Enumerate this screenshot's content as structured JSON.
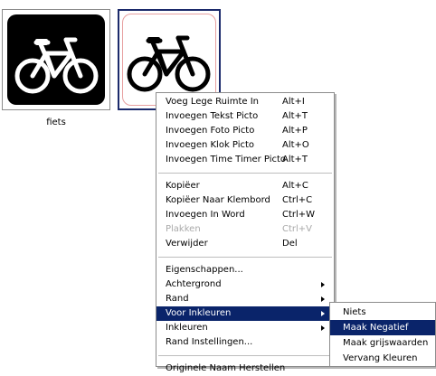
{
  "tiles": [
    {
      "label": "fiets",
      "style": "negative",
      "icon": "bicycle-icon"
    },
    {
      "label": "",
      "style": "normal",
      "icon": "bicycle-icon"
    }
  ],
  "context_menu": {
    "group1": [
      {
        "label": "Voeg Lege Ruimte In",
        "shortcut": "Alt+I"
      },
      {
        "label": "Invoegen Tekst Picto",
        "shortcut": "Alt+T"
      },
      {
        "label": "Invoegen Foto Picto",
        "shortcut": "Alt+P"
      },
      {
        "label": "Invoegen Klok Picto",
        "shortcut": "Alt+O"
      },
      {
        "label": "Invoegen Time Timer Picto",
        "shortcut": "Alt+T"
      }
    ],
    "group2": [
      {
        "label": "Kopiëer",
        "shortcut": "Alt+C"
      },
      {
        "label": "Kopiëer Naar Klembord",
        "shortcut": "Ctrl+C"
      },
      {
        "label": "Invoegen In Word",
        "shortcut": "Ctrl+W"
      },
      {
        "label": "Plakken",
        "shortcut": "Ctrl+V",
        "disabled": true
      },
      {
        "label": "Verwijder",
        "shortcut": "Del"
      }
    ],
    "group3": [
      {
        "label": "Eigenschappen..."
      },
      {
        "label": "Achtergrond",
        "submenu": true
      },
      {
        "label": "Rand",
        "submenu": true
      },
      {
        "label": "Voor Inkleuren",
        "submenu": true,
        "highlighted": true
      },
      {
        "label": "Inkleuren",
        "submenu": true
      },
      {
        "label": "Rand Instellingen..."
      }
    ],
    "group4": [
      {
        "label": "Originele Naam Herstellen"
      }
    ]
  },
  "submenu": [
    {
      "label": "Niets"
    },
    {
      "label": "Maak Negatief",
      "highlighted": true
    },
    {
      "label": "Maak grijswaarden"
    },
    {
      "label": "Vervang Kleuren"
    }
  ],
  "colors": {
    "highlight": "#0a246a",
    "disabled_text": "#a9a9a9"
  }
}
